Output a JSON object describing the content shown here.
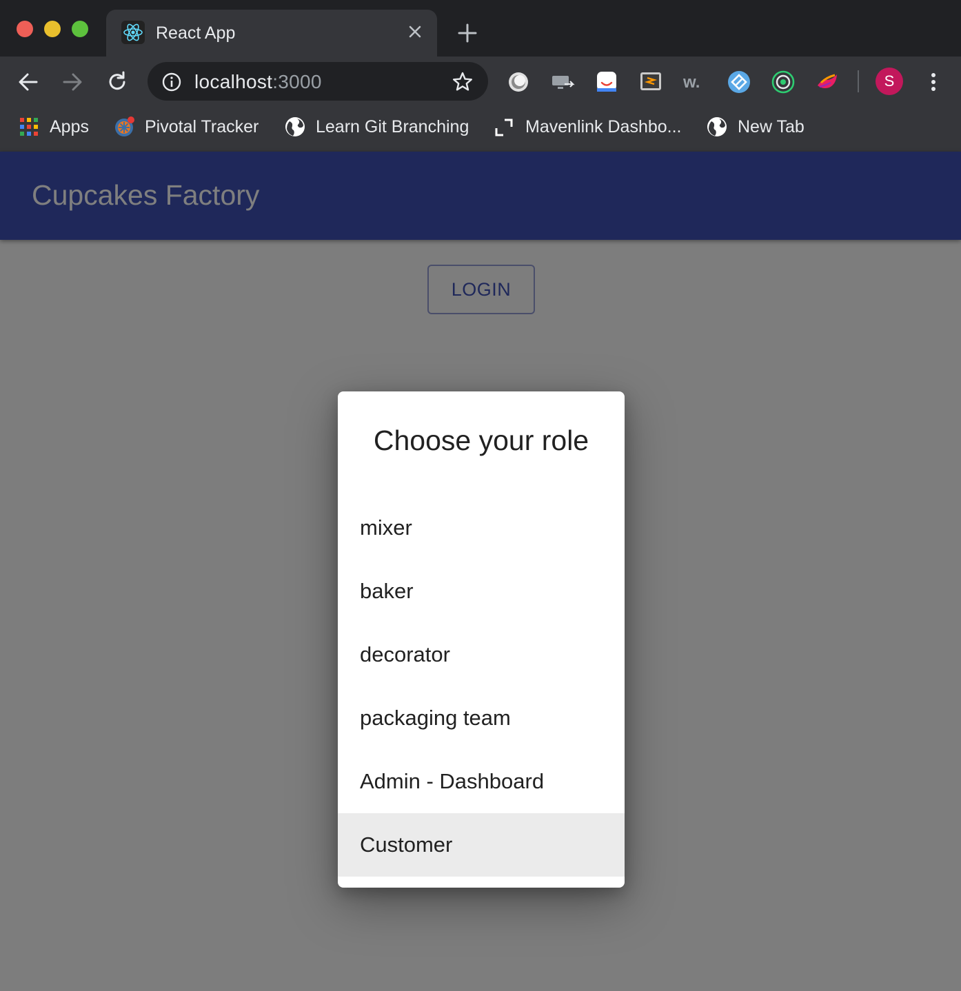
{
  "browser": {
    "tab_title": "React App",
    "url_host": "localhost",
    "url_port": ":3000",
    "profile_initial": "S",
    "bookmarks": [
      {
        "label": "Apps",
        "icon": "apps-grid-icon"
      },
      {
        "label": "Pivotal Tracker",
        "icon": "pivotal-tracker-icon"
      },
      {
        "label": "Learn Git Branching",
        "icon": "globe-icon"
      },
      {
        "label": "Mavenlink Dashbo...",
        "icon": "mavenlink-icon"
      },
      {
        "label": "New Tab",
        "icon": "globe-icon"
      }
    ],
    "extensions": [
      "extension-circle-icon",
      "extension-cast-icon",
      "extension-chat-icon",
      "extension-sublime-icon",
      "extension-w-icon",
      "extension-diamond-icon",
      "extension-target-icon",
      "extension-bird-icon"
    ]
  },
  "app": {
    "title": "Cupcakes Factory",
    "login_label": "LOGIN"
  },
  "dialog": {
    "title": "Choose your role",
    "roles": [
      "mixer",
      "baker",
      "decorator",
      "packaging team",
      "Admin - Dashboard",
      "Customer"
    ],
    "hovered_role": "Customer"
  },
  "colors": {
    "appbar": "#3f51b5",
    "chrome_dark": "#202124",
    "chrome_toolbar": "#35363a",
    "avatar": "#c2185b"
  }
}
